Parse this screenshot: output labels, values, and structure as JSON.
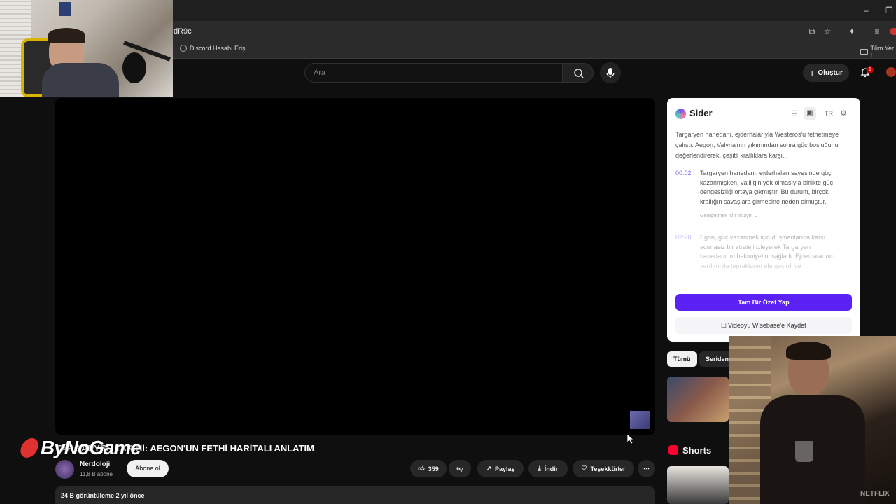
{
  "browser": {
    "url": "dR9c",
    "bookmarks": [
      {
        "label": "Discord Hesabı Erişi..."
      },
      {
        "label": "Tüm Yer İ"
      }
    ],
    "window_controls": {
      "minimize": "–",
      "maximize": "❐"
    }
  },
  "header": {
    "search_placeholder": "Ara",
    "create_label": "Oluştur",
    "notification_count": "1"
  },
  "video": {
    "title": "TARGARYEN TARİHİ: AEGON'UN FETHİ HARİTALI ANLATIM",
    "channel_name": "Nerdoloji",
    "subscribers": "11,8 B abone",
    "subscribe_label": "Abone ol",
    "likes": "359",
    "share_label": "Paylaş",
    "download_label": "İndir",
    "thanks_label": "Teşekkürler",
    "more_label": "⋯",
    "views_date": "24 B görüntüleme  2 yıl önce"
  },
  "watermark": {
    "text": "ByNoGame"
  },
  "sider": {
    "title": "Sider",
    "lang": "TR",
    "summary": "Targaryen hanedanı, ejderhalarıyla Westeros'u fethetmeye çalıştı. Aegon, Valyria'nın yıkımından sonra güç boşluğunu değerlendirerek, çeşitli krallıklara karşı...",
    "items": [
      {
        "time": "00:02",
        "text": "Targaryen hanedanı, ejderhaları sayesinde güç kazanmışken, valiliğin yok olmasıyla birlikte güç dengesizliği ortaya çıkmıştır. Bu durum, birçok krallığın savaşlara girmesine neden olmuştur."
      },
      {
        "time": "02:20",
        "text": "Egon, güç kazanmak için düşmanlarına karşı acımasız bir strateji izleyerek Targaryen hanedanının hakimiyetini sağladı. Ejderhalarının yardımıyla topraklarını ele geçirdi ve"
      }
    ],
    "expand_hint": "Genişletmek için tıklayın ⌄",
    "summarize_label": "Tam Bir Özet Yap",
    "save_label": "Videoyu Wisebase'e Kaydet"
  },
  "sidebar": {
    "chips": [
      "Tümü",
      "Seriden"
    ],
    "shorts_label": "Shorts"
  },
  "overlay": {
    "netflix_label": "NETFLIX"
  },
  "colors": {
    "background": "#0f0f0f",
    "accent_purple": "#5b21f5",
    "youtube_red": "#ff0033"
  }
}
